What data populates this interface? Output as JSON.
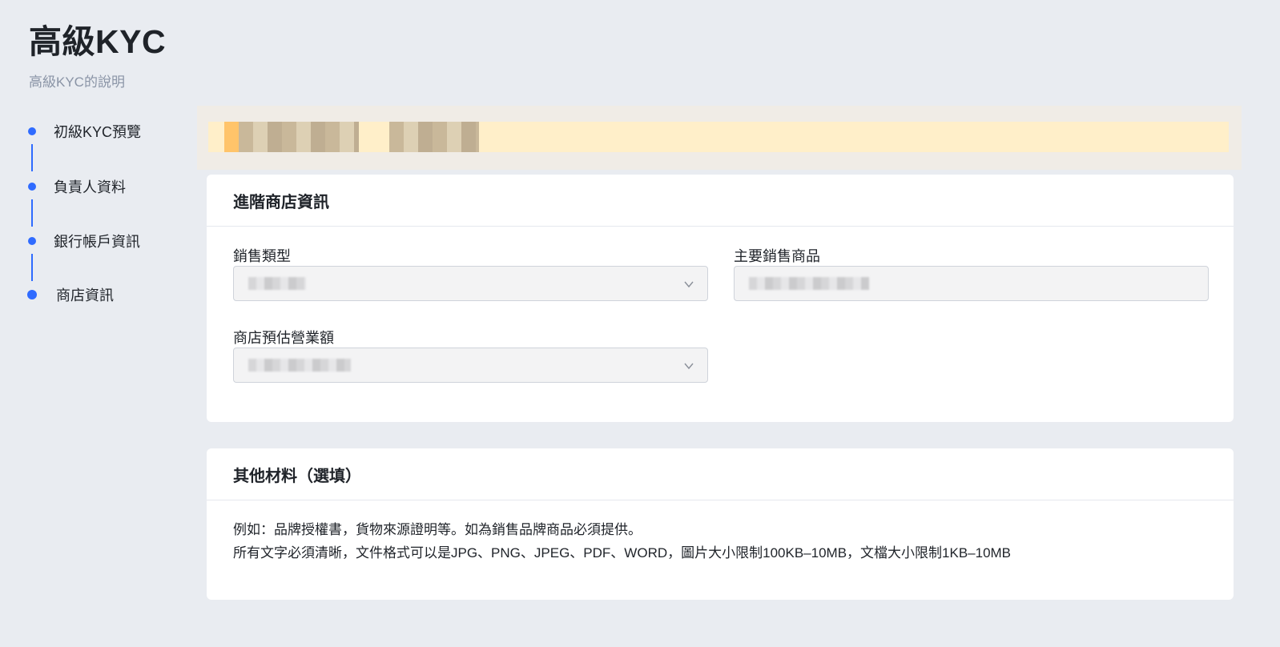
{
  "page": {
    "title": "高級KYC",
    "subtitle": "高級KYC的說明"
  },
  "steps": [
    {
      "label": "初級KYC預覽"
    },
    {
      "label": "負責人資料"
    },
    {
      "label": "銀行帳戶資訊"
    },
    {
      "label": "商店資訊",
      "active": true
    }
  ],
  "notice": {
    "text": ""
  },
  "store_card": {
    "title": "進階商店資訊",
    "sales_type": {
      "label": "銷售類型",
      "value": "",
      "icon": "chevron-down-icon"
    },
    "main_products": {
      "label": "主要銷售商品",
      "value": ""
    },
    "estimated_revenue": {
      "label": "商店預估營業額",
      "value": "",
      "icon": "chevron-down-icon"
    }
  },
  "other_card": {
    "title": "其他材料（選填）",
    "line1": "例如：品牌授權書，貨物來源證明等。如為銷售品牌商品必須提供。",
    "line2": "所有文字必須清晰，文件格式可以是JPG、PNG、JPEG、PDF、WORD，圖片大小限制100KB–10MB，文檔大小限制1KB–10MB"
  },
  "colors": {
    "accent": "#2f6bff",
    "background": "#e9ecf1",
    "card": "#ffffff",
    "notice": "#ffefc9"
  }
}
